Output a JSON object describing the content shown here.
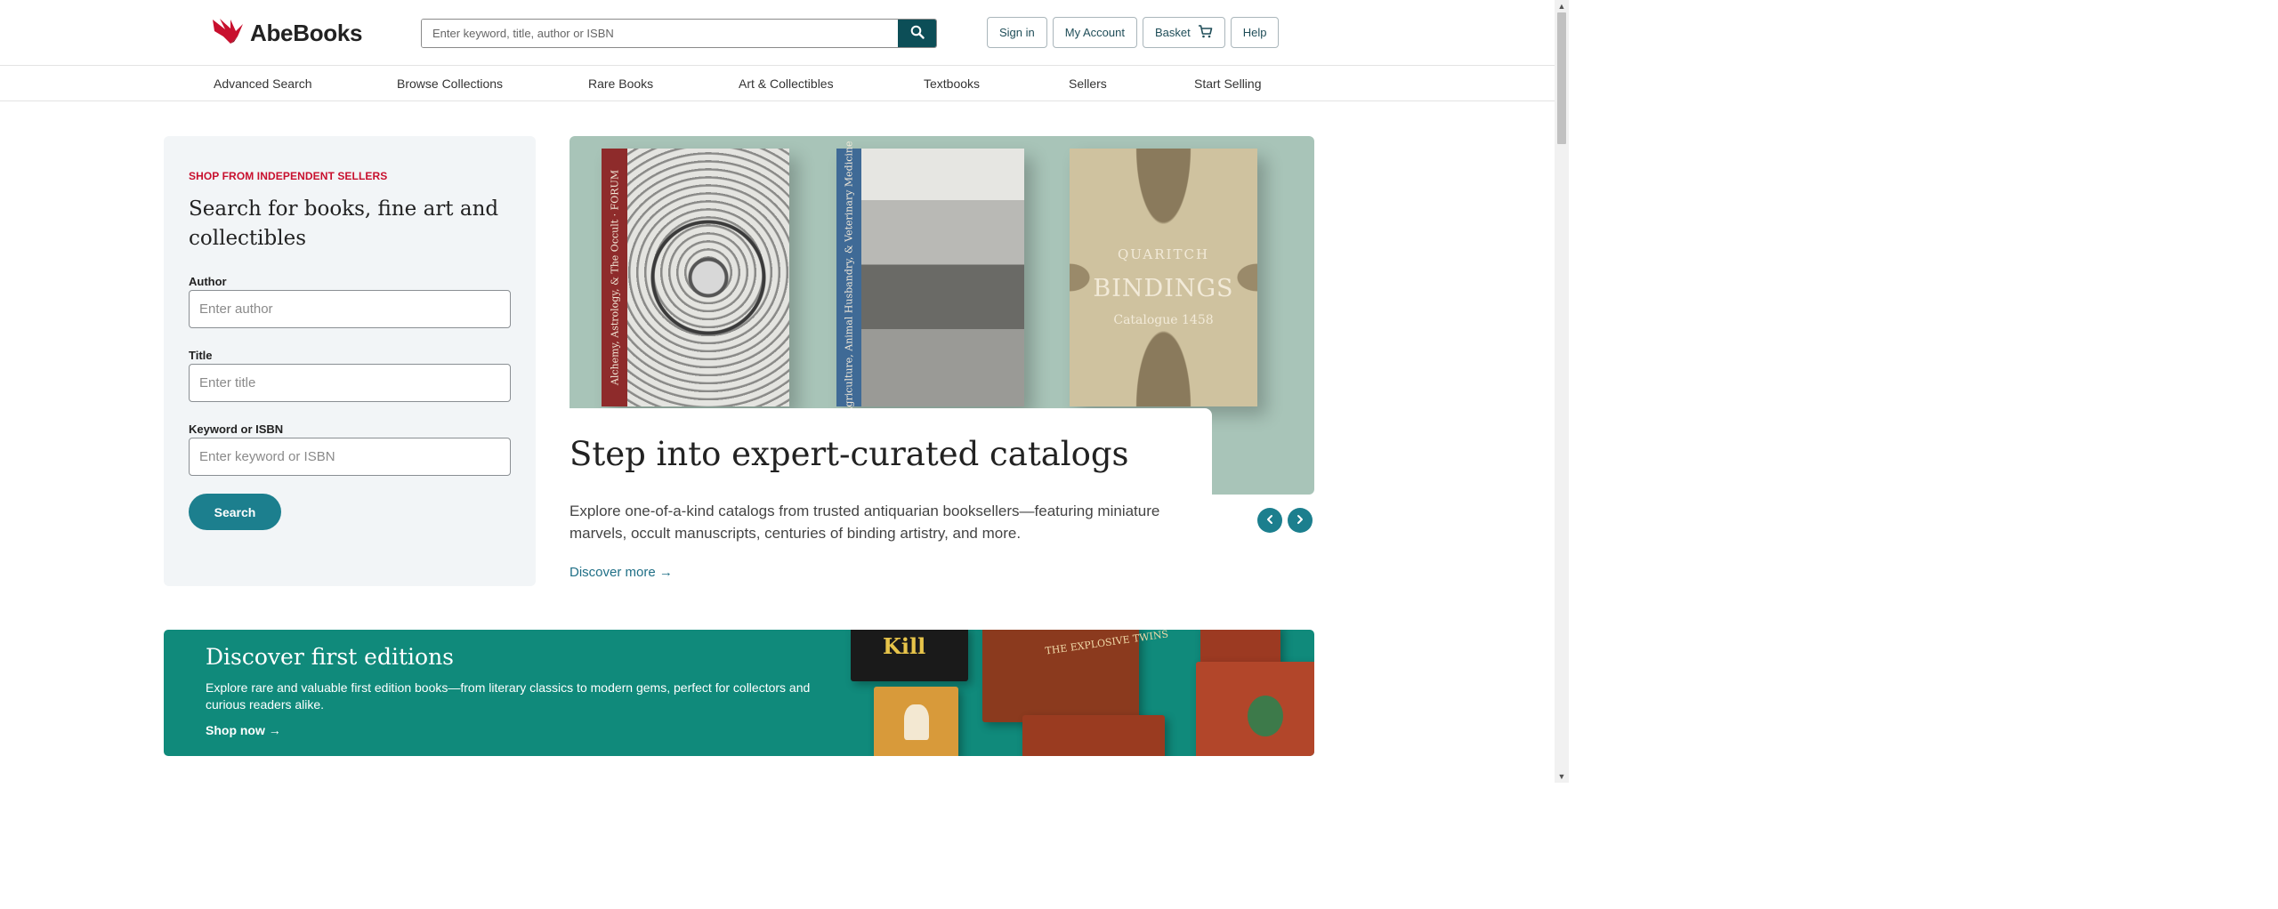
{
  "brand": {
    "name": "AbeBooks",
    "logo_icon": "bird-logo-icon",
    "logo_color": "#c8102e"
  },
  "header": {
    "search": {
      "placeholder": "Enter keyword, title, author or ISBN",
      "icon": "search-icon"
    },
    "buttons": {
      "sign_in": "Sign in",
      "my_account": "My Account",
      "basket": "Basket",
      "help": "Help"
    }
  },
  "nav": {
    "items": [
      "Advanced Search",
      "Browse Collections",
      "Rare Books",
      "Art & Collectibles",
      "Textbooks",
      "Sellers",
      "Start Selling"
    ]
  },
  "search_panel": {
    "eyebrow": "SHOP FROM INDEPENDENT SELLERS",
    "title": "Search for books, fine art and collectibles",
    "author": {
      "label": "Author",
      "placeholder": "Enter author"
    },
    "title_field": {
      "label": "Title",
      "placeholder": "Enter title"
    },
    "keyword": {
      "label": "Keyword or ISBN",
      "placeholder": "Enter keyword or ISBN"
    },
    "search_button": "Search"
  },
  "hero": {
    "books": [
      {
        "spine_text": "Alchemy, Astrology, & The Occult · FORUM"
      },
      {
        "spine_text": "Agriculture, Animal Husbandry, & Veterinary Medicine"
      },
      {
        "cover_lines": [
          "QUARITCH",
          "BINDINGS",
          "Catalogue 1458"
        ]
      }
    ],
    "title": "Step into expert-curated catalogs",
    "description": "Explore one-of-a-kind catalogs from trusted antiquarian booksellers—featuring miniature marvels, occult manuscripts, centuries of binding artistry, and more.",
    "link": "Discover more →",
    "accent_color": "#1c7f8e"
  },
  "banner": {
    "title": "Discover first editions",
    "description": "Explore rare and valuable first edition books—from literary classics to modern gems, perfect for collectors and curious readers alike.",
    "link": "Shop now →",
    "background": "#108a7b",
    "book_texts": [
      "Kill",
      "THE EXPLOSIVE TWINS"
    ]
  },
  "colors": {
    "accent_dark": "#0c4e57",
    "accent": "#1c7f8e",
    "eyebrow_red": "#c8102e"
  }
}
